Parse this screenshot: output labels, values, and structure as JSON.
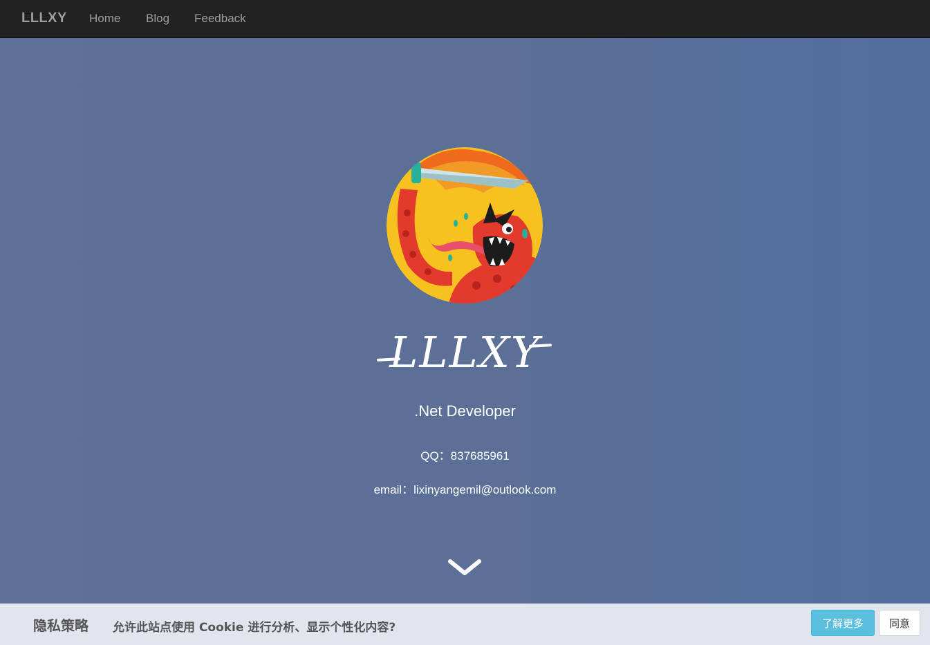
{
  "nav": {
    "brand": "LLLXY",
    "links": [
      "Home",
      "Blog",
      "Feedback"
    ]
  },
  "profile": {
    "name": "LLLXY",
    "role": ".Net Developer",
    "qq": "QQ：837685961",
    "email": "email：lixinyangemil@outlook.com",
    "avatar_icon": "monster-avatar-illustration"
  },
  "cookie_banner": {
    "title": "隐私策略",
    "message": "允许此站点使用 Cookie 进行分析、显示个性化内容?",
    "learn_more_label": "了解更多",
    "agree_label": "同意"
  },
  "colors": {
    "navbar": "#222222",
    "hero_background": "#5b6f96",
    "cookie_bar": "#e1e5ee",
    "learn_more_button": "#5bc0de"
  }
}
